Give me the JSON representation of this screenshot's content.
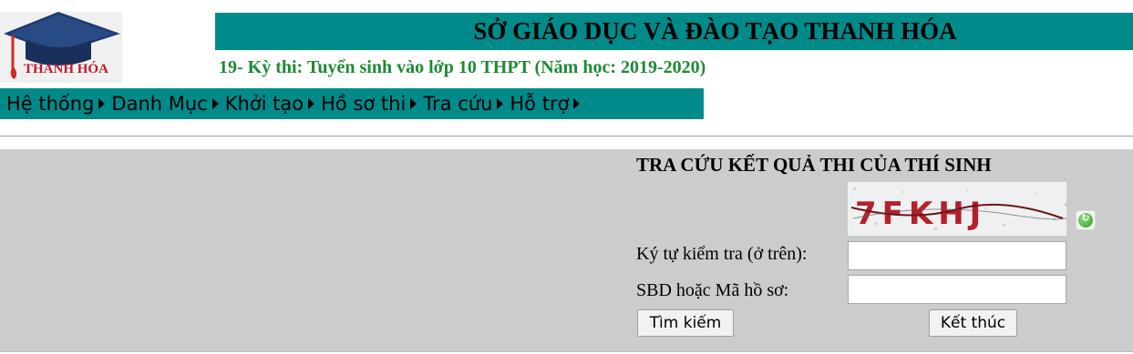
{
  "header": {
    "logo_text": "THANH HÓA",
    "title": "SỞ GIÁO DỤC VÀ ĐÀO TẠO THANH HÓA",
    "exam_info": "19- Kỳ thi: Tuyển sinh vào lớp 10 THPT (Năm học: 2019-2020)"
  },
  "menu": {
    "items": [
      {
        "label": "Hệ thống"
      },
      {
        "label": "Danh Mục"
      },
      {
        "label": "Khởi tạo"
      },
      {
        "label": "Hồ sơ thi"
      },
      {
        "label": "Tra cứu"
      },
      {
        "label": "Hỗ trợ"
      }
    ]
  },
  "lookup": {
    "title": "TRA CỨU KẾT QUẢ THI CỦA THÍ SINH",
    "captcha_text": "7FKHJ",
    "captcha_label": "Ký tự kiểm tra (ở trên):",
    "captcha_value": "",
    "id_label": "SBD hoặc Mã hồ sơ:",
    "id_value": "",
    "search_button": "Tìm kiếm",
    "end_button": "Kết thúc"
  },
  "colors": {
    "header_bar": "#008a8a",
    "exam_text": "#1e8a35",
    "panel": "#cccccc",
    "logo_text": "#c0182b"
  },
  "icons": {
    "logo": "graduation-cap-icon",
    "refresh": "refresh-icon",
    "menu_arrow": "caret-right-icon"
  }
}
